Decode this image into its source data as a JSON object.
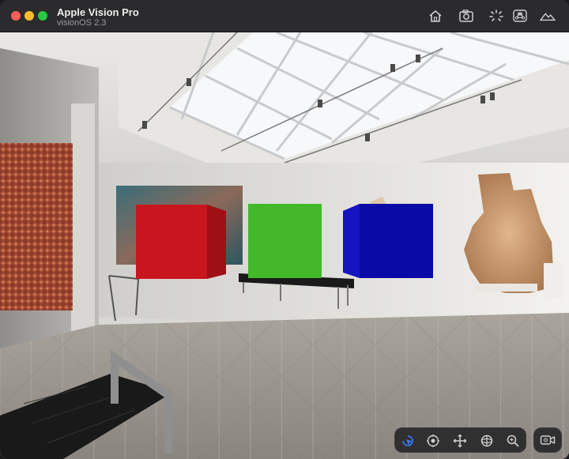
{
  "window": {
    "title": "Apple Vision Pro",
    "subtitle": "visionOS 2.3"
  },
  "toolbar": {
    "icons": [
      "home-icon",
      "screenshot-camera-icon",
      "brightness-icon",
      "keyboard-command-icon",
      "landscape-environment-icon"
    ]
  },
  "viewport": {
    "scene": "museum gallery environment",
    "cubes": [
      {
        "name": "red-cube",
        "color": "#c8161f"
      },
      {
        "name": "green-cube",
        "color": "#43b82a"
      },
      {
        "name": "blue-cube",
        "color": "#0a0aa6"
      }
    ]
  },
  "controls": {
    "active_tool": "interact",
    "tools": [
      "interact-rotate-icon",
      "look-around-icon",
      "pan-move-icon",
      "orbit-icon",
      "zoom-icon"
    ],
    "capture_icon": "record-video-icon",
    "accent": "#3d7cff"
  }
}
